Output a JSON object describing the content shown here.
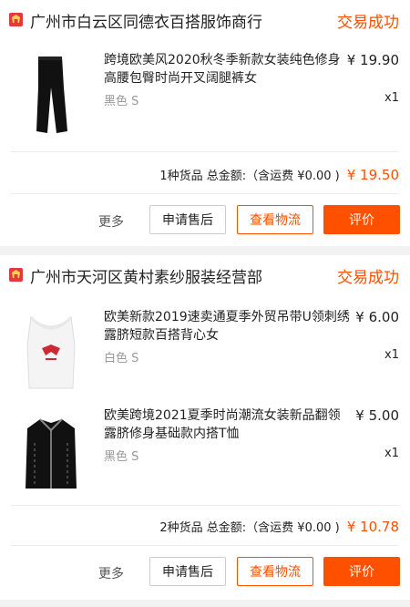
{
  "colors": {
    "accent": "#ff5000",
    "shop_icon": "#e4393c"
  },
  "orders": [
    {
      "shop_name": "广州市白云区同德衣百搭服饰商行",
      "status": "交易成功",
      "items": [
        {
          "title": "跨境欧美风2020秋冬季新款女装纯色修身高腰包臀时尚开叉阔腿裤女",
          "price": "¥ 19.90",
          "variant": "黑色 S",
          "qty": "x1",
          "thumb_icon": "black-flare-pants"
        }
      ],
      "summary": "1种货品 总金额:（含运费 ¥0.00 )",
      "total": "¥ 19.50",
      "actions": {
        "more": "更多",
        "service": "申请售后",
        "logistics": "查看物流",
        "review": "评价"
      }
    },
    {
      "shop_name": "广州市天河区黄村素纱服装经营部",
      "status": "交易成功",
      "items": [
        {
          "title": "欧美新款2019速卖通夏季外贸吊带U领刺绣露脐短款百搭背心女",
          "price": "¥ 6.00",
          "variant": "白色 S",
          "qty": "x1",
          "thumb_icon": "white-crop-tank"
        },
        {
          "title": "欧美跨境2021夏季时尚潮流女装新品翻领露脐修身基础款内搭T恤",
          "price": "¥ 5.00",
          "variant": "黑色 S",
          "qty": "x1",
          "thumb_icon": "black-zip-crop-top"
        }
      ],
      "summary": "2种货品 总金额:（含运费 ¥0.00 )",
      "total": "¥ 10.78",
      "actions": {
        "more": "更多",
        "service": "申请售后",
        "logistics": "查看物流",
        "review": "评价"
      }
    }
  ]
}
